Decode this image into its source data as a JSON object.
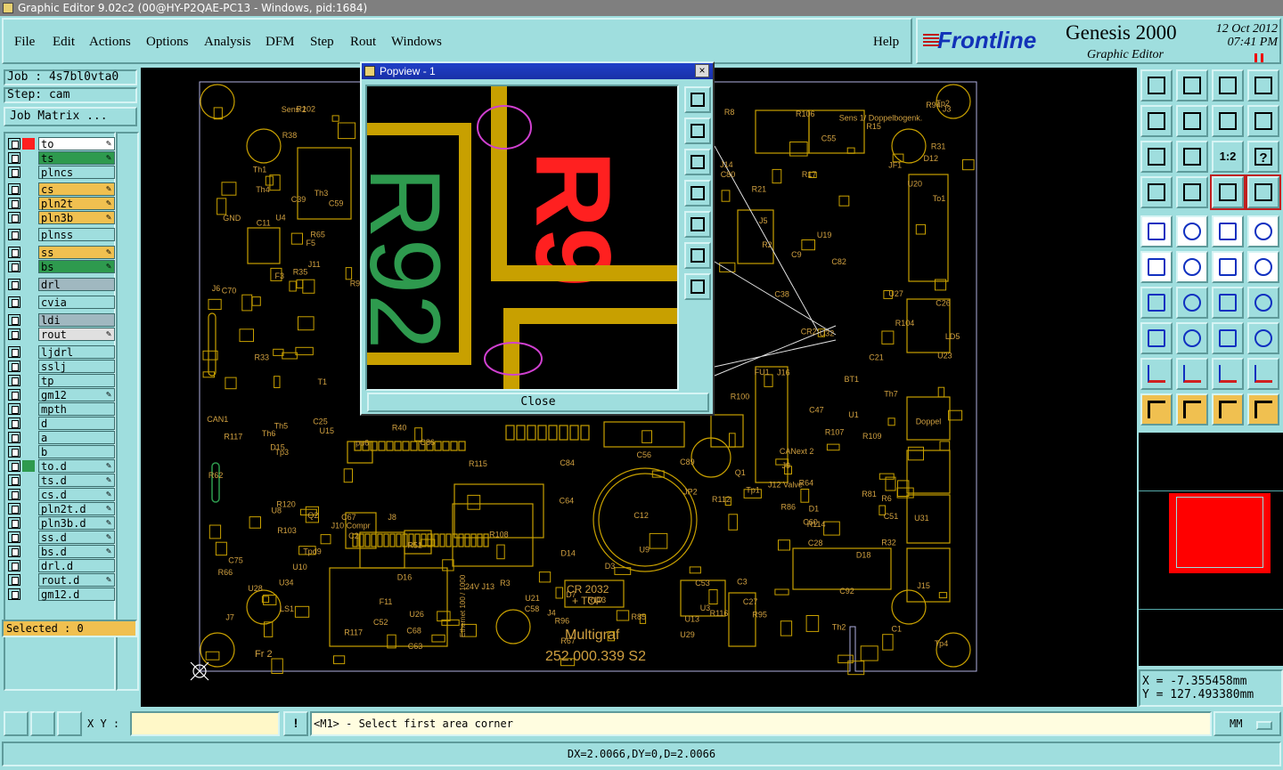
{
  "window": {
    "title": "Graphic Editor 9.02c2 (00@HY-P2QAE-PC13 - Windows, pid:1684)"
  },
  "menu": {
    "items": [
      "File",
      "Edit",
      "Actions",
      "Options",
      "Analysis",
      "DFM",
      "Step",
      "Rout",
      "Windows"
    ],
    "help": "Help"
  },
  "brand": {
    "logo": "Frontline",
    "product": "Genesis 2000",
    "subtitle": "Graphic Editor",
    "date": "12 Oct 2012",
    "time": "07:41 PM"
  },
  "job": {
    "job_label": "Job : 4s7bl0vta0",
    "step_label": "Step: cam",
    "matrix_button": "Job Matrix ..."
  },
  "layers": [
    {
      "name": "to",
      "color": "#ffffff",
      "swatch": "#ff2020",
      "editable": true
    },
    {
      "name": "ts",
      "color": "#2e9a4e",
      "swatch": "",
      "editable": true
    },
    {
      "name": "plncs",
      "color": "#9fdede",
      "swatch": "",
      "editable": false
    },
    {
      "name": "cs",
      "color": "#f0c050",
      "swatch": "",
      "editable": true
    },
    {
      "name": "pln2t",
      "color": "#f0c050",
      "swatch": "",
      "editable": true
    },
    {
      "name": "pln3b",
      "color": "#f0c050",
      "swatch": "",
      "editable": true
    },
    {
      "name": "plnss",
      "color": "#9fdede",
      "swatch": "",
      "editable": false
    },
    {
      "name": "ss",
      "color": "#f0c050",
      "swatch": "",
      "editable": true
    },
    {
      "name": "bs",
      "color": "#2e9a4e",
      "swatch": "",
      "editable": true
    },
    {
      "name": "drl",
      "color": "#a0b8c0",
      "swatch": "",
      "editable": false
    },
    {
      "name": "cvia",
      "color": "#9fdede",
      "swatch": "",
      "editable": false
    },
    {
      "name": "ldi",
      "color": "#a0b8c0",
      "swatch": "",
      "editable": false
    },
    {
      "name": "rout",
      "color": "#e0e0e0",
      "swatch": "",
      "editable": true
    },
    {
      "name": "ljdrl",
      "color": "#9fdede",
      "swatch": "",
      "editable": false
    },
    {
      "name": "sslj",
      "color": "#9fdede",
      "swatch": "",
      "editable": false
    },
    {
      "name": "tp",
      "color": "#9fdede",
      "swatch": "",
      "editable": false
    },
    {
      "name": "gm12",
      "color": "#9fdede",
      "swatch": "",
      "editable": true
    },
    {
      "name": "mpth",
      "color": "#9fdede",
      "swatch": "",
      "editable": false
    },
    {
      "name": "d",
      "color": "#9fdede",
      "swatch": "",
      "editable": false
    },
    {
      "name": "a",
      "color": "#9fdede",
      "swatch": "",
      "editable": false
    },
    {
      "name": "b",
      "color": "#9fdede",
      "swatch": "",
      "editable": false
    },
    {
      "name": "to.d",
      "color": "#9fdede",
      "swatch": "#2e9a4e",
      "editable": true
    },
    {
      "name": "ts.d",
      "color": "#9fdede",
      "swatch": "",
      "editable": true
    },
    {
      "name": "cs.d",
      "color": "#9fdede",
      "swatch": "",
      "editable": true
    },
    {
      "name": "pln2t.d",
      "color": "#9fdede",
      "swatch": "",
      "editable": true
    },
    {
      "name": "pln3b.d",
      "color": "#9fdede",
      "swatch": "",
      "editable": true
    },
    {
      "name": "ss.d",
      "color": "#9fdede",
      "swatch": "",
      "editable": true
    },
    {
      "name": "bs.d",
      "color": "#9fdede",
      "swatch": "",
      "editable": true
    },
    {
      "name": "drl.d",
      "color": "#9fdede",
      "swatch": "",
      "editable": false
    },
    {
      "name": "rout.d",
      "color": "#9fdede",
      "swatch": "",
      "editable": true
    },
    {
      "name": "gm12.d",
      "color": "#9fdede",
      "swatch": "",
      "editable": false
    }
  ],
  "selected_label": "Selected : 0",
  "popview": {
    "title": "Popview - 1",
    "close_x": "×",
    "close_button": "Close",
    "silk_text": "R92",
    "red_text": "R9"
  },
  "board": {
    "labels": [
      "Th3",
      "Th4",
      "Th5",
      "Th6",
      "Th2",
      "Th7",
      "Th1",
      "C89",
      "C2",
      "C3",
      "R115",
      "C12",
      "R6",
      "R3",
      "Tp1",
      "Tp2",
      "Tp3",
      "Tp4",
      "C9",
      "U3",
      "U4",
      "R17",
      "U10",
      "C28",
      "R21",
      "Tpd9",
      "pu6",
      "R35",
      "U21",
      "C38",
      "C39",
      "C52",
      "C53",
      "R31",
      "C55",
      "C56",
      "C58",
      "C59",
      "C60",
      "R64",
      "R120",
      "U26",
      "U29",
      "R116",
      "C67",
      "C70",
      "U1",
      "J11",
      "JP2",
      "R86",
      "C80",
      "BT1",
      "CR2",
      "C82",
      "R100",
      "R103",
      "R104",
      "U32",
      "R96",
      "R95",
      "C75",
      "To1",
      "R102",
      "R106",
      "U31",
      "F3",
      "C86",
      "J16",
      "GND",
      "C68",
      "C64",
      "C63",
      "R67",
      "JF1",
      "Q1",
      "U28",
      "R112",
      "U27",
      "U34",
      "R91",
      "R113",
      "R94",
      "C84",
      "U13",
      "D15",
      "R107",
      "R117",
      "F5",
      "J14",
      "FU1",
      "J15",
      "LS1",
      "D18",
      "R108",
      "R109",
      "Q2",
      "D16",
      "D14",
      "R85",
      "C92",
      "R114",
      "J3",
      "J4",
      "CAN1",
      "CANext 2",
      "R117",
      "F11",
      "C11",
      "T1",
      "J6",
      "R8",
      "R15",
      "C26",
      "C27",
      "D3",
      "R40",
      "LD5",
      "Doppel",
      "Sens 1/ Doppelbogenk.",
      "J7",
      "J8",
      "Sens 2",
      "J10 Compr",
      "J12 Valve",
      "24V J13",
      "R2",
      "D1",
      "C1",
      "U8",
      "J5",
      "C25",
      "C21",
      "U9",
      "R32",
      "R33",
      "U15",
      "R38",
      "U19",
      "U20",
      "R62",
      "R51",
      "C47",
      "D12",
      "D7",
      "U23",
      "R66",
      "C51",
      "R65",
      "R81",
      "J9"
    ],
    "silkscreen_title": "Multigraf",
    "part_number": "252.000.339 S2",
    "cr_label": "CR 2032",
    "cr_sub": "+ TOP",
    "eth_label": "Ethernet 100 / 1000",
    "fr": "Fr 2"
  },
  "toolbar": {
    "rows": [
      [
        "home-icon-1",
        "copy-icon",
        "house-icon",
        "window-icon"
      ],
      [
        "undo-icon",
        "redo-icon",
        "swap-icon",
        "flip-icon"
      ],
      [
        "fit-icon",
        "center-icon",
        "ratio-icon",
        "help-icon"
      ],
      [
        "measure-icon",
        "drill-icon",
        "snap-icon",
        "snap2-icon"
      ],
      [
        "select-shape-icon",
        "line-icon",
        "ruler-icon",
        "pad-icon"
      ],
      [
        "net-icon",
        "cross-icon",
        "arc-icon",
        "point-icon"
      ],
      [
        "angle-icon",
        "diagonal-icon",
        "rotate-icon",
        "mirror-icon"
      ],
      [
        "flag-icon",
        "bar-icon",
        "dimension-icon",
        "cluster-icon"
      ],
      [
        "triangle-icon",
        "triangle2-icon",
        "triangle3-icon",
        "triangle4-icon"
      ],
      [
        "pointer-icon",
        "pointer2-icon",
        "pointer3-icon",
        "route-icon"
      ]
    ],
    "ratio_label": "1:2",
    "help_label": "?"
  },
  "coords": {
    "x": "X = -7.355458mm",
    "y": "Y = 127.493380mm"
  },
  "bottom": {
    "xy_label": "X Y :",
    "xy_value": "",
    "warn": "!",
    "prompt": "<M1> - Select first area corner",
    "units": "MM",
    "status": "DX=2.0066,DY=0,D=2.0066"
  },
  "colors": {
    "panel": "#9fdede",
    "copper": "#c8a000",
    "silk": "#d0a040",
    "red_layer": "#ff2020",
    "green_layer": "#2e9a4e"
  }
}
